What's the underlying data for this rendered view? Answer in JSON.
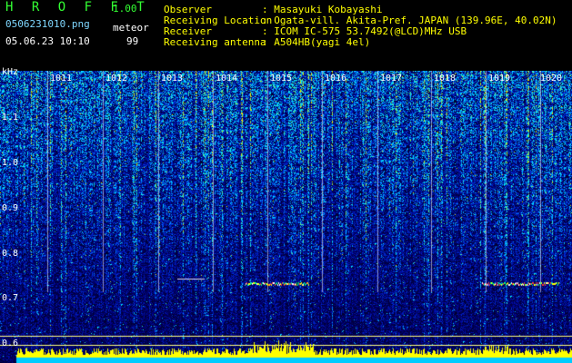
{
  "header": {
    "brand": "H R O F F T",
    "version": "1.00",
    "filename": "0506231010.png",
    "mode_label": "meteor",
    "datetime": "05.06.23 10:10",
    "meteor_count": "99",
    "fields": [
      {
        "label": "Observer",
        "value": ": Masayuki Kobayashi"
      },
      {
        "label": "Receiving Location",
        "value": ": Ogata-vill. Akita-Pref. JAPAN (139.96E, 40.02N)"
      },
      {
        "label": "Receiver",
        "value": ": ICOM IC-575 53.7492(@LCD)MHz USB"
      },
      {
        "label": "Receiving antenna",
        "value": ": A504HB(yagi 4el)"
      }
    ]
  },
  "spectrogram": {
    "unit": "kHz",
    "y_ticks": [
      "1.1",
      "1.0",
      "0.9",
      "0.8",
      "0.7",
      "0.6"
    ],
    "minute_labels": [
      "1011",
      "1012",
      "1013",
      "1014",
      "1015",
      "1016",
      "1017",
      "1018",
      "1019",
      "1020"
    ],
    "colors": {
      "bg": "#000000",
      "text": "#ffffff",
      "accent": "#33ff33",
      "trace": "#ffff00",
      "fill": "#00ccff"
    }
  }
}
